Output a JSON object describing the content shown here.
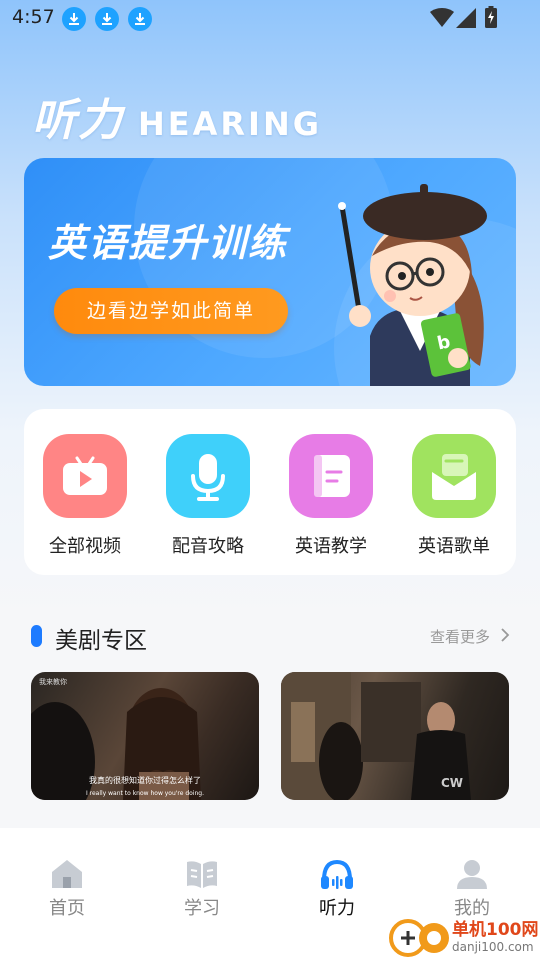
{
  "status_bar": {
    "time": "4:57",
    "icons": [
      "download-icon",
      "download-icon",
      "download-icon",
      "wifi-icon",
      "signal-icon",
      "battery-charging-icon"
    ]
  },
  "header": {
    "title_cn": "听力",
    "title_en": "HEARING"
  },
  "banner": {
    "title": "英语提升训练",
    "button_label": "边看边学如此简单",
    "colors": {
      "background": "#3d9cfa",
      "button": "#ff8c0f"
    }
  },
  "categories": [
    {
      "label": "全部视频",
      "icon": "tv-play-icon",
      "color": "#ff8585"
    },
    {
      "label": "配音攻略",
      "icon": "microphone-icon",
      "color": "#3fd0fa"
    },
    {
      "label": "英语教学",
      "icon": "book-icon",
      "color": "#e77ce6"
    },
    {
      "label": "英语歌单",
      "icon": "envelope-music-icon",
      "color": "#a0e35f"
    }
  ],
  "section": {
    "title": "美剧专区",
    "more_label": "查看更多",
    "accent": "#1d7bff"
  },
  "videos": [
    {
      "subtitle_cn": "我真的很想知道你过得怎么样了",
      "subtitle_en": "I really want to know how you're doing.",
      "watermark": "我来教你"
    },
    {
      "badge": "CW"
    }
  ],
  "tabs": [
    {
      "label": "首页",
      "icon": "home-icon",
      "active": false
    },
    {
      "label": "学习",
      "icon": "open-book-icon",
      "active": false
    },
    {
      "label": "听力",
      "icon": "headphones-icon",
      "active": true
    },
    {
      "label": "我的",
      "icon": "person-icon",
      "active": false
    }
  ],
  "watermark": {
    "line1": "单机100网",
    "line2": "danji100.com"
  }
}
